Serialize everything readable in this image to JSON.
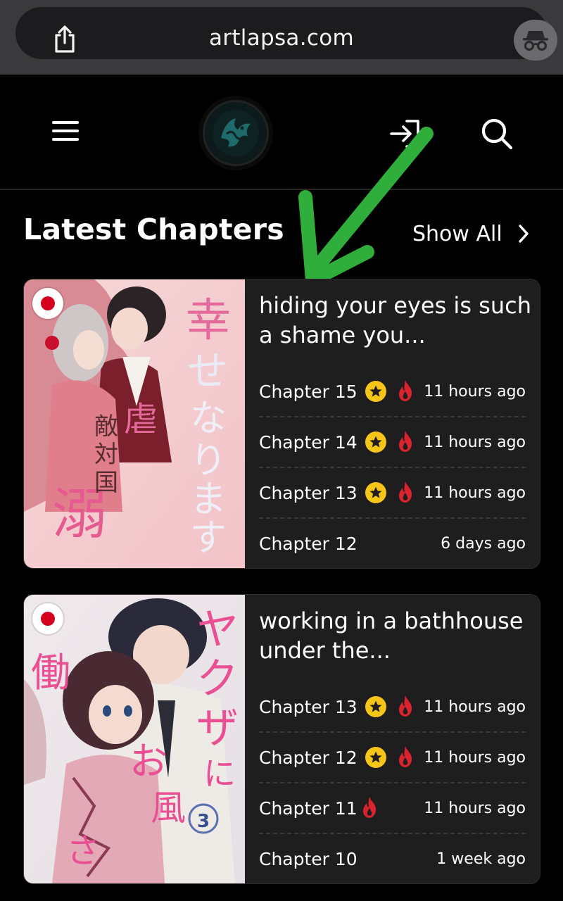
{
  "browser": {
    "url": "artlapsa.com",
    "share_icon": "share-icon",
    "incognito_icon": "incognito-icon"
  },
  "nav": {
    "menu_icon": "menu-icon",
    "logo_icon": "site-logo",
    "login_icon": "login-icon",
    "search_icon": "search-icon"
  },
  "section": {
    "title": "Latest Chapters",
    "show_all": "Show All"
  },
  "cards": [
    {
      "title": "hiding your eyes is such a shame you...",
      "chapters": [
        {
          "name": "Chapter 15",
          "time": "11 hours ago",
          "star": true,
          "fire": true
        },
        {
          "name": "Chapter 14",
          "time": "11 hours ago",
          "star": true,
          "fire": true
        },
        {
          "name": "Chapter 13",
          "time": "11 hours ago",
          "star": true,
          "fire": true
        },
        {
          "name": "Chapter 12",
          "time": "6 days ago",
          "star": false,
          "fire": false
        }
      ]
    },
    {
      "title": "working in a bathhouse under the...",
      "chapters": [
        {
          "name": "Chapter 13",
          "time": "11 hours ago",
          "star": true,
          "fire": true
        },
        {
          "name": "Chapter 12",
          "time": "11 hours ago",
          "star": true,
          "fire": true
        },
        {
          "name": "Chapter 11",
          "time": "11 hours ago",
          "star": false,
          "fire": true
        },
        {
          "name": "Chapter 10",
          "time": "1 week ago",
          "star": false,
          "fire": false
        }
      ]
    }
  ],
  "colors": {
    "background": "#000000",
    "card": "#1e1e1e",
    "star": "#f5c518",
    "fire": "#d9232e",
    "annotation_arrow": "#2fae3c"
  }
}
